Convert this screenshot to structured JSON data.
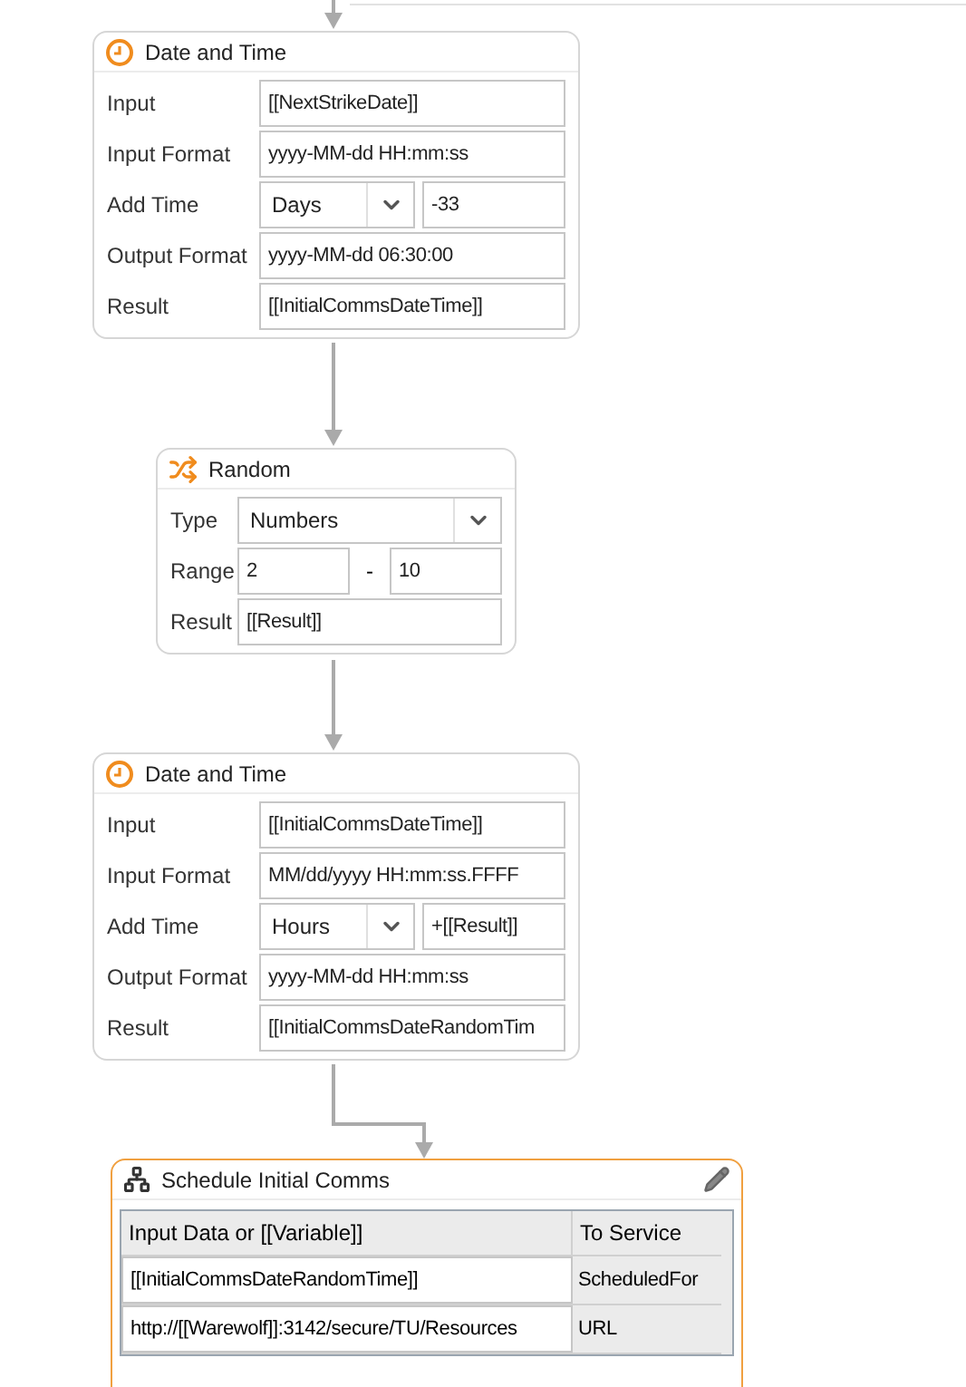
{
  "nodes": [
    {
      "kind": "datetime",
      "title": "Date and Time",
      "rows": [
        {
          "label": "Input",
          "kind": "text",
          "value": "[[NextStrikeDate]]"
        },
        {
          "label": "Input Format",
          "kind": "text",
          "value": "yyyy-MM-dd HH:mm:ss"
        },
        {
          "label": "Add Time",
          "kind": "select_text",
          "option": "Days",
          "value": "-33"
        },
        {
          "label": "Output Format",
          "kind": "text",
          "value": "yyyy-MM-dd 06:30:00"
        },
        {
          "label": "Result",
          "kind": "text",
          "value": "[[InitialCommsDateTime]]"
        }
      ]
    },
    {
      "kind": "random",
      "title": "Random",
      "rows": [
        {
          "label": "Type",
          "kind": "select",
          "option": "Numbers"
        },
        {
          "label": "Range",
          "kind": "range",
          "from": "2",
          "separator": "-",
          "to": "10"
        },
        {
          "label": "Result",
          "kind": "text",
          "value": "[[Result]]"
        }
      ]
    },
    {
      "kind": "datetime",
      "title": "Date and Time",
      "rows": [
        {
          "label": "Input",
          "kind": "text",
          "value": "[[InitialCommsDateTime]]"
        },
        {
          "label": "Input Format",
          "kind": "text",
          "value": "MM/dd/yyyy HH:mm:ss.FFFF"
        },
        {
          "label": "Add Time",
          "kind": "select_text",
          "option": "Hours",
          "value": "+[[Result]]"
        },
        {
          "label": "Output Format",
          "kind": "text",
          "value": "yyyy-MM-dd HH:mm:ss"
        },
        {
          "label": "Result",
          "kind": "text",
          "value": "[[InitialCommsDateRandomTim"
        }
      ]
    },
    {
      "kind": "service",
      "title": "Schedule Initial Comms",
      "selected": true,
      "columns": [
        "Input Data or [[Variable]]",
        "To Service"
      ],
      "rows": [
        [
          "[[InitialCommsDateRandomTime]]",
          "ScheduledFor"
        ],
        [
          "http://[[Warewolf]]:3142/secure/TU/Resources",
          "URL"
        ]
      ]
    }
  ]
}
